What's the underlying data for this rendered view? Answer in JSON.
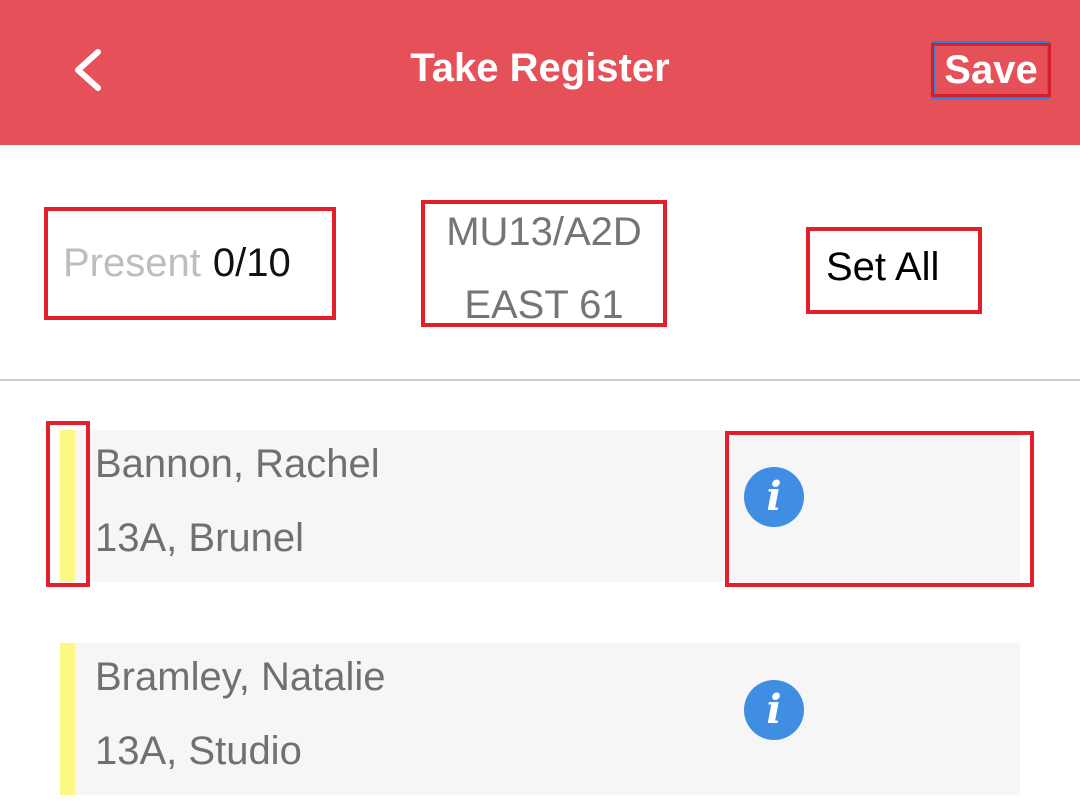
{
  "header": {
    "title": "Take Register",
    "save_label": "Save",
    "back_icon": "chevron-left-icon"
  },
  "summary": {
    "present_label": "Present",
    "present_count": "0/10",
    "course_code": "MU13/A2D",
    "room": "EAST 61",
    "set_all_label": "Set All"
  },
  "students": [
    {
      "name": "Bannon, Rachel",
      "detail": "13A, Brunel",
      "info_icon": "info-icon"
    },
    {
      "name": "Bramley, Natalie",
      "detail": "13A, Studio",
      "info_icon": "info-icon"
    }
  ],
  "colors": {
    "header_bg": "#e65058",
    "status_strip": "#fbf884",
    "info_icon_bg": "#3f8ee3"
  }
}
